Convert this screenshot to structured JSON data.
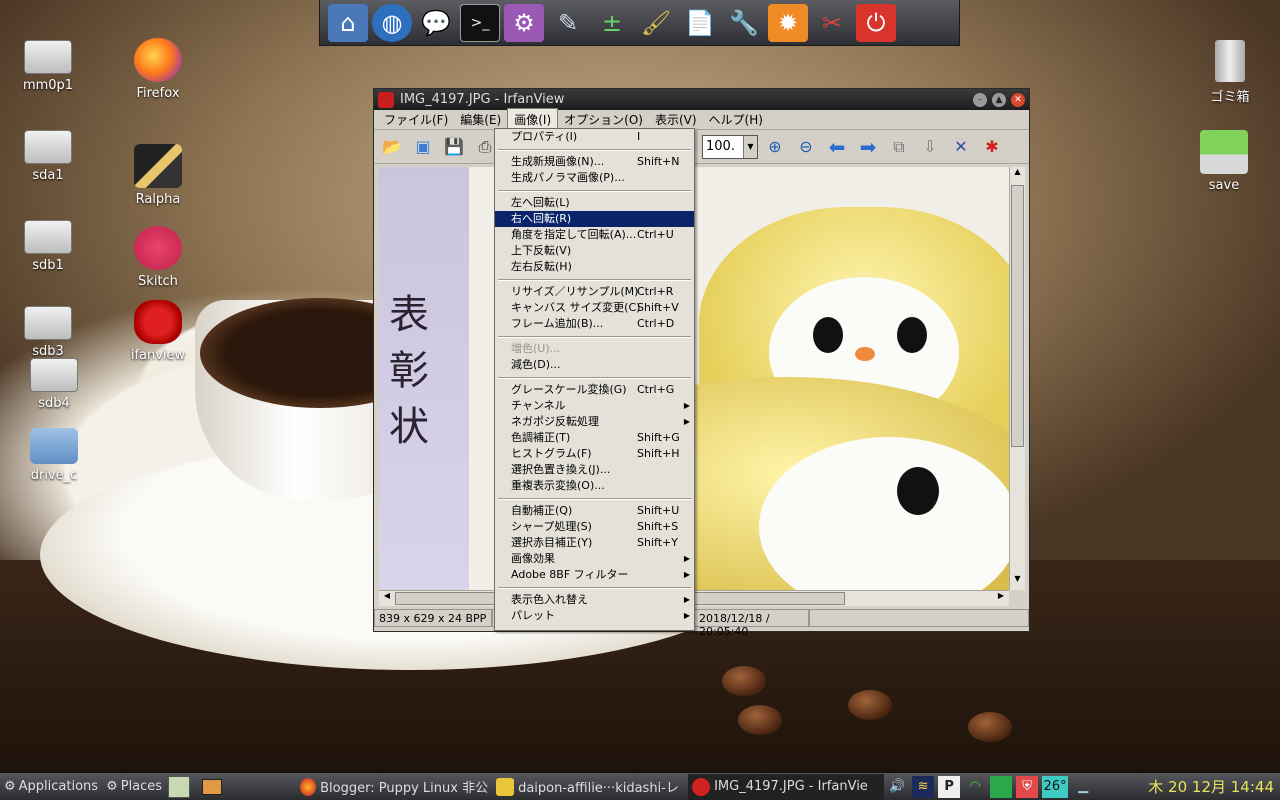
{
  "desktop": {
    "left_icons": [
      {
        "label": "mm0p1"
      },
      {
        "label": "sda1"
      },
      {
        "label": "sdb1"
      },
      {
        "label": "sdb3"
      },
      {
        "label": "sdb4"
      },
      {
        "label": "drive_c"
      }
    ],
    "app_icons": [
      {
        "label": "Firefox"
      },
      {
        "label": "Ralpha"
      },
      {
        "label": "Skitch"
      },
      {
        "label": "ifanview"
      }
    ],
    "right_icons": [
      {
        "label": "ゴミ箱"
      },
      {
        "label": "save"
      }
    ]
  },
  "launcher": {
    "icons": [
      "home-icon",
      "globe-icon",
      "chat-icon",
      "terminal-icon",
      "settings-icon",
      "text-editor-icon",
      "calculator-icon",
      "paint-icon",
      "document-icon",
      "tools-icon",
      "system-settings-icon",
      "swiss-knife-icon",
      "power-icon"
    ]
  },
  "window": {
    "title": "IMG_4197.JPG - IrfanView",
    "menu": [
      "ファイル(F)",
      "編集(E)",
      "画像(I)",
      "オプション(O)",
      "表示(V)",
      "ヘルプ(H)"
    ],
    "active_menu": "画像(I)",
    "zoom_value": "100.",
    "status": {
      "dimensions": "839 x 629 x 24 BPP",
      "datetime": "2018/12/18 / 20:05:40"
    },
    "image_text": "表彰状"
  },
  "dropdown": {
    "items": [
      {
        "label": "プロパティ(I)",
        "shortcut": "I"
      },
      {
        "sep": true
      },
      {
        "label": "生成新規画像(N)...",
        "shortcut": "Shift+N"
      },
      {
        "label": "生成パノラマ画像(P)..."
      },
      {
        "sep": true
      },
      {
        "label": "左へ回転(L)"
      },
      {
        "label": "右へ回転(R)",
        "highlighted": true
      },
      {
        "label": "角度を指定して回転(A)...",
        "shortcut": "Ctrl+U"
      },
      {
        "label": "上下反転(V)"
      },
      {
        "label": "左右反転(H)"
      },
      {
        "sep": true
      },
      {
        "label": "リサイズ／リサンプル(M)",
        "shortcut": "Ctrl+R"
      },
      {
        "label": "キャンバス サイズ変更(C)",
        "shortcut": "Shift+V"
      },
      {
        "label": "フレーム追加(B)...",
        "shortcut": "Ctrl+D"
      },
      {
        "sep": true
      },
      {
        "label": "増色(U)...",
        "disabled": true
      },
      {
        "label": "減色(D)..."
      },
      {
        "sep": true
      },
      {
        "label": "グレースケール変換(G)",
        "shortcut": "Ctrl+G"
      },
      {
        "label": "チャンネル",
        "submenu": true
      },
      {
        "label": "ネガポジ反転処理",
        "submenu": true
      },
      {
        "label": "色調補正(T)",
        "shortcut": "Shift+G"
      },
      {
        "label": "ヒストグラム(F)",
        "shortcut": "Shift+H"
      },
      {
        "label": "選択色置き換え(J)..."
      },
      {
        "label": "重複表示変換(O)..."
      },
      {
        "sep": true
      },
      {
        "label": "自動補正(Q)",
        "shortcut": "Shift+U"
      },
      {
        "label": "シャープ処理(S)",
        "shortcut": "Shift+S"
      },
      {
        "label": "選択赤目補正(Y)",
        "shortcut": "Shift+Y"
      },
      {
        "label": "画像効果",
        "submenu": true
      },
      {
        "label": "Adobe 8BF フィルター",
        "submenu": true
      },
      {
        "sep": true
      },
      {
        "label": "表示色入れ替え",
        "submenu": true
      },
      {
        "label": "パレット",
        "submenu": true
      }
    ]
  },
  "taskbar": {
    "applications": "Applications",
    "places": "Places",
    "tasks": [
      {
        "label": "Blogger: Puppy Linux 非公"
      },
      {
        "label": "daipon-affilie···kidashi-レ"
      },
      {
        "label": "IMG_4197.JPG - IrfanVie"
      }
    ],
    "temperature": "26°",
    "clock": "木 20 12月 14:44"
  },
  "colors": {
    "menu_highlight": "#0a246a",
    "clock": "#e8e35a",
    "window_bg": "#d4d0c8"
  }
}
